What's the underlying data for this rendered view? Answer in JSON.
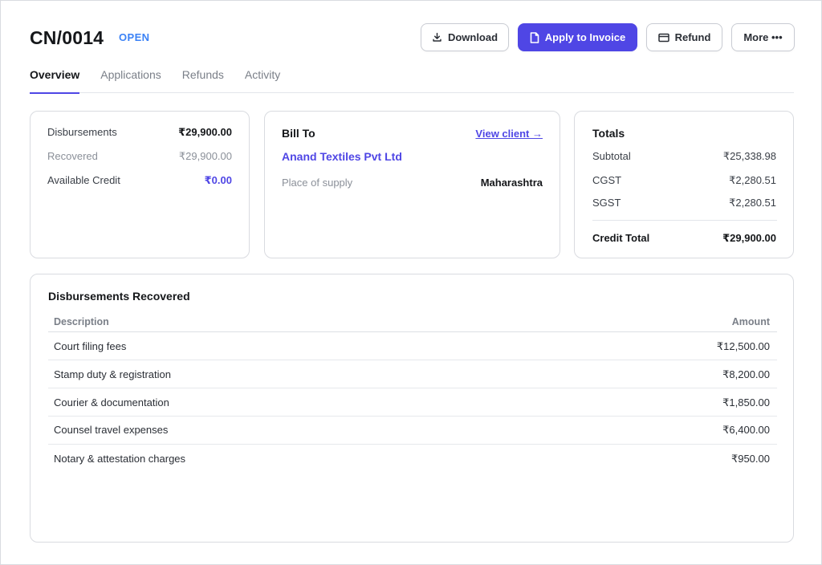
{
  "header": {
    "title": "CN/0014",
    "status": "OPEN",
    "buttons": {
      "download": "Download",
      "apply": "Apply to Invoice",
      "refund": "Refund",
      "more": "More •••"
    }
  },
  "tabs": [
    "Overview",
    "Applications",
    "Refunds",
    "Activity"
  ],
  "summary": {
    "disbursements_label": "Disbursements",
    "disbursements_value": "₹29,900.00",
    "recovered_label": "Recovered",
    "recovered_value": "₹29,900.00",
    "available_label": "Available Credit",
    "available_value": "₹0.00"
  },
  "bill_to": {
    "title": "Bill To",
    "view_client": "View client →",
    "client_name": "Anand Textiles Pvt Ltd",
    "supply_label": "Place of supply",
    "supply_value": "Maharashtra"
  },
  "totals": {
    "title": "Totals",
    "subtotal_label": "Subtotal",
    "subtotal_value": "₹25,338.98",
    "cgst_label": "CGST",
    "cgst_value": "₹2,280.51",
    "sgst_label": "SGST",
    "sgst_value": "₹2,280.51",
    "credit_total_label": "Credit Total",
    "credit_total_value": "₹29,900.00"
  },
  "disbursements_table": {
    "title": "Disbursements Recovered",
    "columns": [
      "Description",
      "Amount"
    ],
    "rows": [
      {
        "description": "Court filing fees",
        "amount": "₹12,500.00"
      },
      {
        "description": "Stamp duty & registration",
        "amount": "₹8,200.00"
      },
      {
        "description": "Courier & documentation",
        "amount": "₹1,850.00"
      },
      {
        "description": "Counsel travel expenses",
        "amount": "₹6,400.00"
      },
      {
        "description": "Notary & attestation charges",
        "amount": "₹950.00"
      }
    ]
  },
  "colors": {
    "accent": "#4f46e5",
    "status": "#3b82f6"
  }
}
